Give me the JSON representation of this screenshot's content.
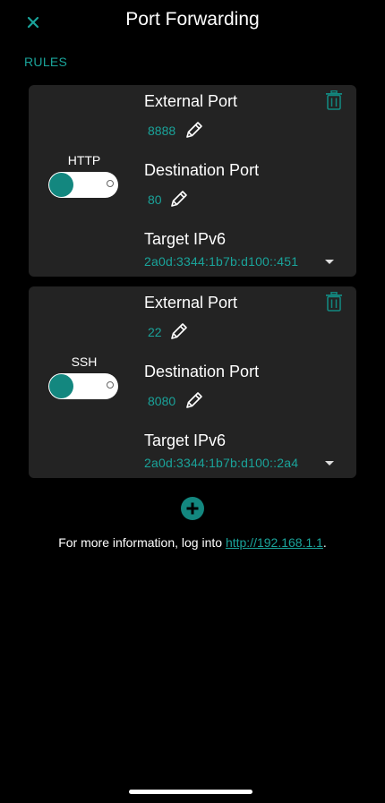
{
  "header": {
    "title": "Port Forwarding",
    "close_icon": "close-icon"
  },
  "section_label": "RULES",
  "rules": [
    {
      "name": "HTTP",
      "enabled": true,
      "external_port_label": "External Port",
      "external_port": "8888",
      "destination_port_label": "Destination Port",
      "destination_port": "80",
      "target_label": "Target IPv6",
      "target_ipv6": "2a0d:3344:1b7b:d100::451"
    },
    {
      "name": "SSH",
      "enabled": true,
      "external_port_label": "External Port",
      "external_port": "22",
      "destination_port_label": "Destination Port",
      "destination_port": "8080",
      "target_label": "Target IPv6",
      "target_ipv6": "2a0d:3344:1b7b:d100::2a4"
    }
  ],
  "footer": {
    "info_prefix": "For more information, log into ",
    "info_link": "http://192.168.1.1",
    "info_suffix": "."
  },
  "colors": {
    "accent": "#1aa39a",
    "toggle_knob": "#13877f",
    "card_background": "#232323",
    "page_background": "#000000"
  }
}
